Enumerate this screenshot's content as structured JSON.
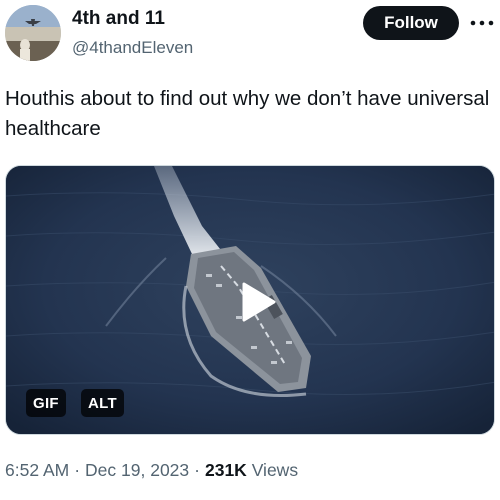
{
  "author": {
    "display_name": "4th and 11",
    "handle": "@4thandEleven"
  },
  "follow_label": "Follow",
  "tweet_text": "Houthis about to find out why we don’t have universal healthcare",
  "media": {
    "badges": {
      "gif": "GIF",
      "alt": "ALT"
    },
    "play_icon": "play-icon"
  },
  "meta": {
    "time": "6:52 AM",
    "separator": "·",
    "date": "Dec 19, 2023",
    "views_count": "231K",
    "views_label": "Views"
  },
  "colors": {
    "text_primary": "#0f1419",
    "text_secondary": "#536471",
    "follow_bg": "#0f1419",
    "sea": "#223148"
  },
  "icons": [
    "more-icon",
    "play-icon"
  ]
}
